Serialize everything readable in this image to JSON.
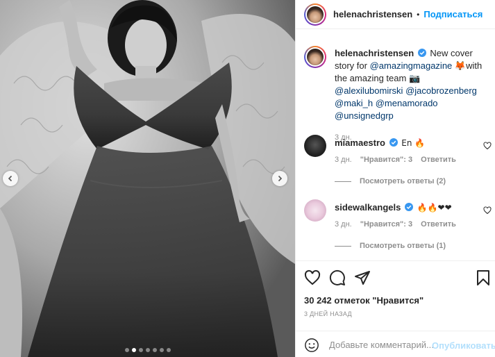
{
  "post": {
    "author": "helenachristensen",
    "follow_label": "Подписаться",
    "separator": "•",
    "caption": {
      "parts": [
        {
          "text": "New cover story for ",
          "type": "text"
        },
        {
          "text": "@amazingmagazine",
          "type": "mention"
        },
        {
          "text": " 🦊with the amazing team 📷 ",
          "type": "text"
        },
        {
          "text": "@alexilubomirski",
          "type": "mention"
        },
        {
          "text": " ",
          "type": "text"
        },
        {
          "text": "@jacobrozenberg",
          "type": "mention"
        },
        {
          "text": " ",
          "type": "text"
        },
        {
          "text": "@maki_h",
          "type": "mention"
        },
        {
          "text": " ",
          "type": "text"
        },
        {
          "text": "@menamorado",
          "type": "mention"
        },
        {
          "text": " ",
          "type": "text"
        },
        {
          "text": "@unsignedgrp",
          "type": "mention"
        }
      ],
      "time": "3 дн."
    },
    "comments": [
      {
        "user": "miamaestro",
        "text": "En 🔥",
        "time": "3 дн.",
        "likes": "\"Нравится\": 3",
        "reply": "Ответить",
        "view_replies": "Посмотреть ответы (2)"
      },
      {
        "user": "sidewalkangels",
        "text": "🔥🔥❤❤",
        "time": "3 дн.",
        "likes": "\"Нравится\": 3",
        "reply": "Ответить",
        "view_replies": "Посмотреть ответы (1)"
      }
    ],
    "likes_text": "30 242 отметок \"Нравится\"",
    "date_text": "3 ДНЕЙ НАЗАД",
    "comment_placeholder": "Добавьте комментарий...",
    "publish_label": "Опубликовать",
    "carousel": {
      "count": 7,
      "active": 1
    }
  },
  "colors": {
    "link": "#00376b",
    "accent": "#0095f6",
    "muted": "#8e8e8e",
    "verified": "#3897f0",
    "publish_disabled": "#b2dffc"
  },
  "icons": [
    "chevron-left-icon",
    "chevron-right-icon",
    "verified-badge-icon",
    "heart-icon",
    "comment-icon",
    "share-icon",
    "bookmark-icon",
    "smile-icon"
  ]
}
